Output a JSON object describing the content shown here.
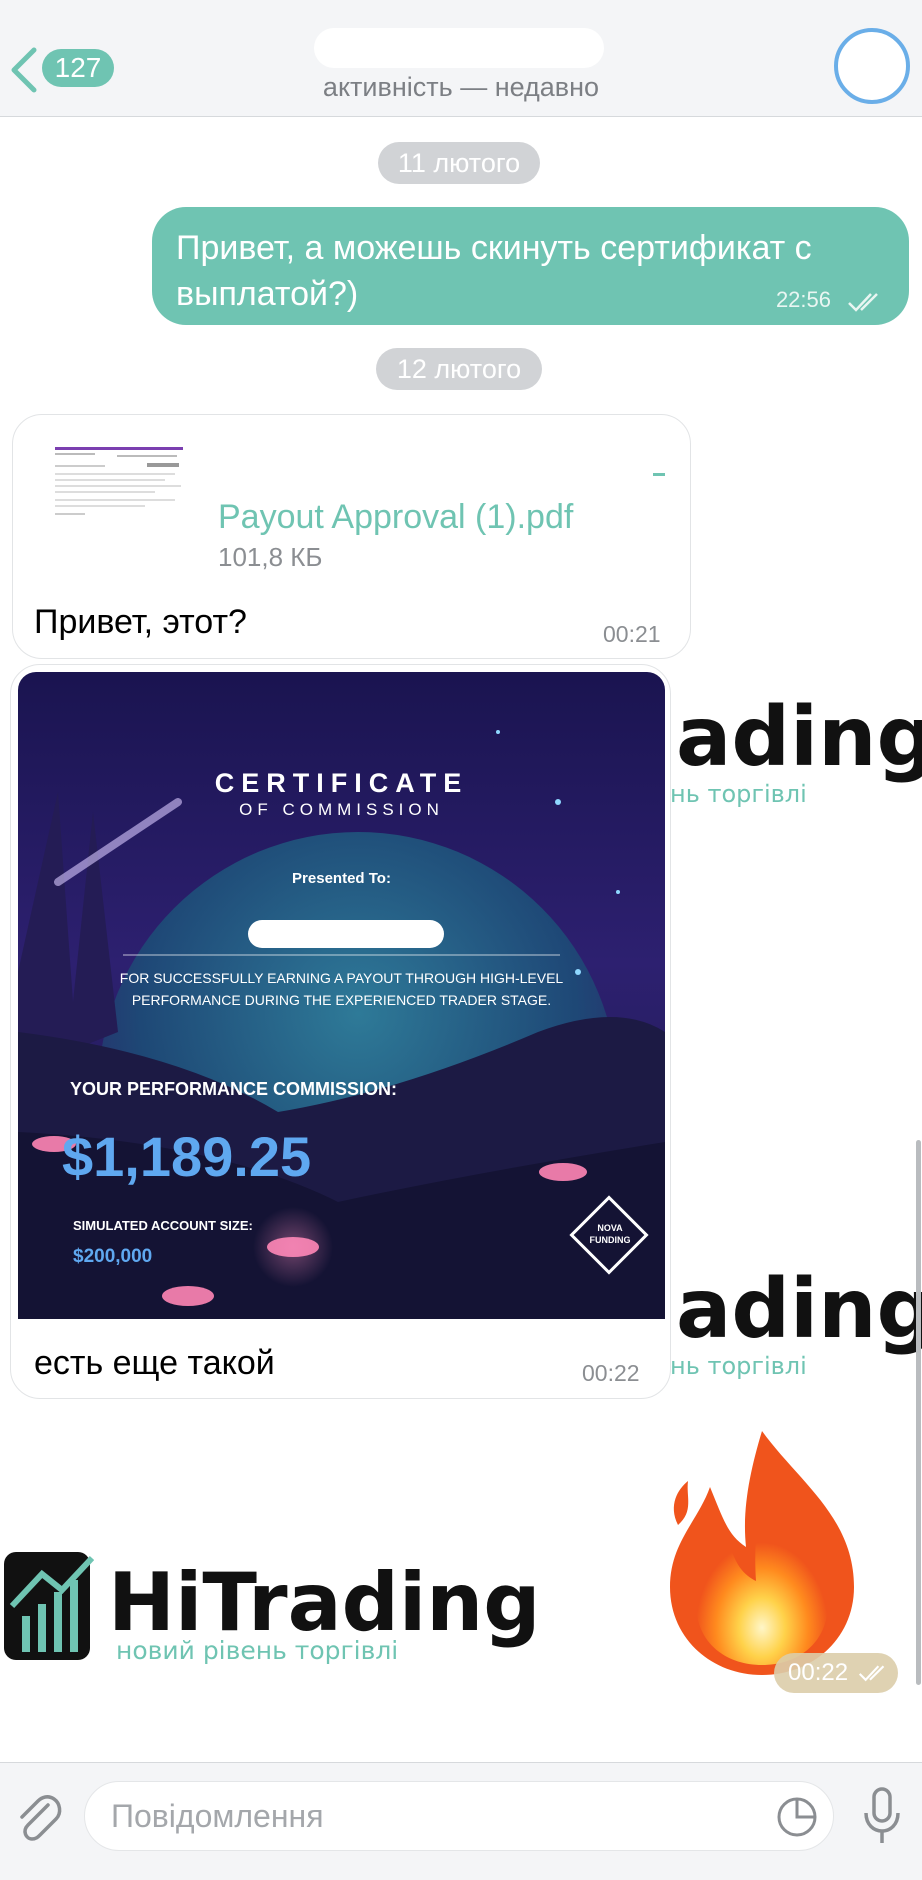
{
  "header": {
    "back_count": "127",
    "status": "активність — недавно"
  },
  "dates": [
    "11 лютого",
    "12 лютого"
  ],
  "messages": {
    "outgoing_1": {
      "text": "Привет, а можешь скинуть сертификат с выплатой?)",
      "time": "22:56"
    },
    "incoming_file": {
      "file_name": "Payout Approval (1).pdf",
      "file_size": "101,8 КБ",
      "text": "Привет, этот?",
      "time": "00:21"
    },
    "incoming_image": {
      "text": "есть еще такой",
      "time": "00:22"
    },
    "emoji_message": {
      "emoji": "🔥",
      "time": "00:22"
    }
  },
  "certificate": {
    "title": "CERTIFICATE",
    "subtitle": "OF COMMISSION",
    "presented_to": "Presented To:",
    "description_1": "FOR SUCCESSFULLY EARNING A PAYOUT THROUGH HIGH-LEVEL",
    "description_2": "PERFORMANCE DURING THE EXPERIENCED TRADER STAGE.",
    "commission_label": "YOUR PERFORMANCE COMMISSION:",
    "amount": "$1,189.25",
    "account_label": "SIMULATED ACCOUNT SIZE:",
    "account_size": "$200,000",
    "logo_line_1": "NOVA",
    "logo_line_2": "FUNDING"
  },
  "wallpaper": {
    "brand": "HiTrading",
    "brand_partial": "ading",
    "tagline": "новий рівень торгівлі",
    "tagline_partial": "нь торгівлі"
  },
  "input": {
    "placeholder": "Повідомлення"
  },
  "colors": {
    "accent": "#6fc4b2",
    "header_bg": "#f4f5f7",
    "avatar_ring": "#6aaee8",
    "cert_amount": "#5fa8f0"
  },
  "icons": [
    "chevron-left-icon",
    "double-check-icon",
    "attach-icon",
    "sticker-icon",
    "microphone-icon",
    "fire-emoji"
  ]
}
